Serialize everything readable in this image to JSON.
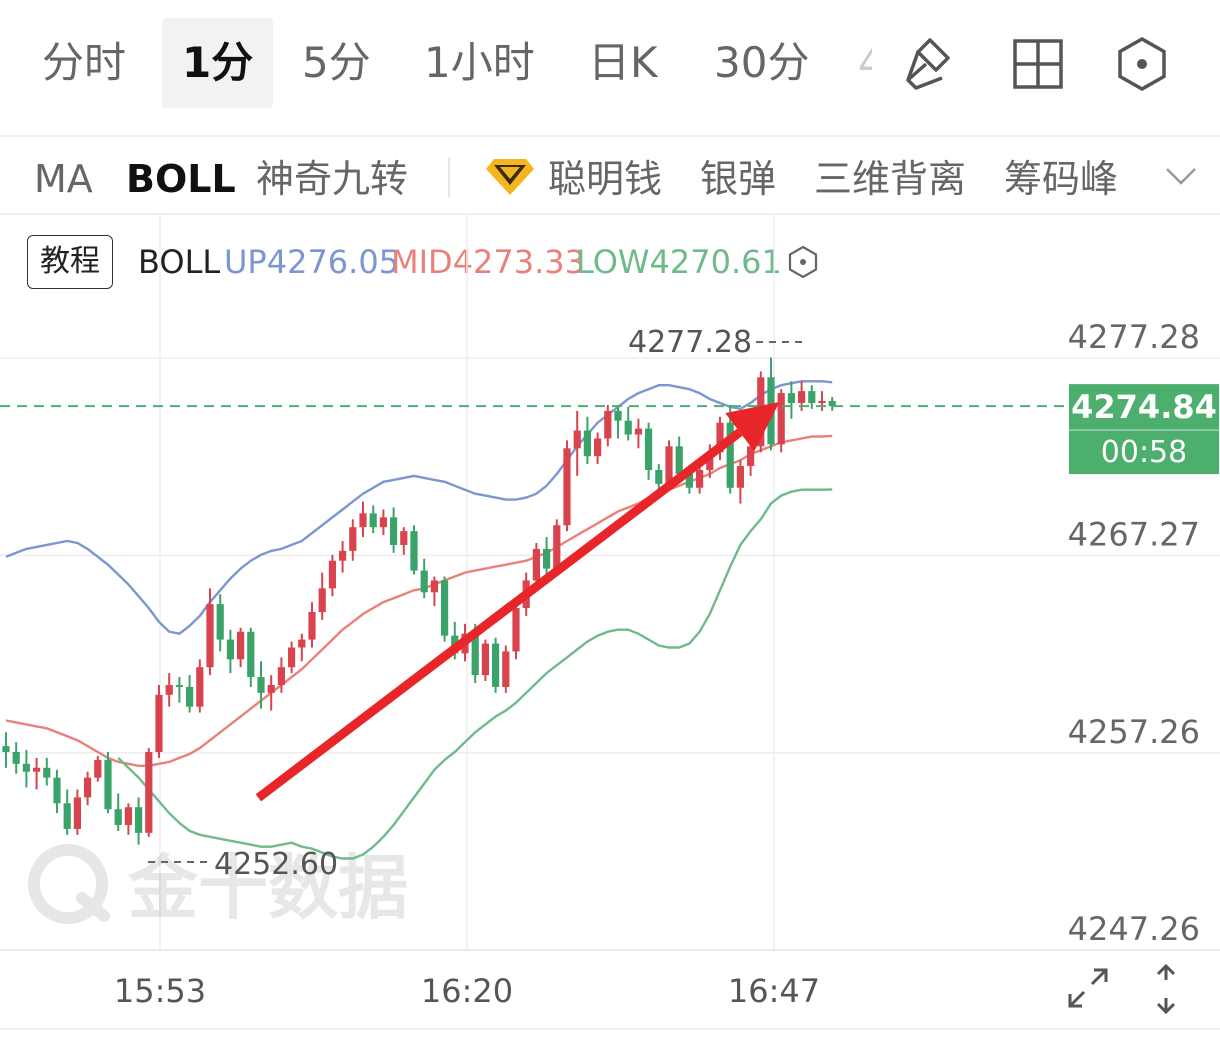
{
  "timeframe_tabs": [
    {
      "label": "分时",
      "active": false
    },
    {
      "label": "1分",
      "active": true
    },
    {
      "label": "5分",
      "active": false
    },
    {
      "label": "1小时",
      "active": false
    },
    {
      "label": "日K",
      "active": false
    },
    {
      "label": "30分",
      "active": false
    },
    {
      "label": "4",
      "active": false
    }
  ],
  "indicator_tabs": [
    {
      "label": "MA",
      "active": false
    },
    {
      "label": "BOLL",
      "active": true
    },
    {
      "label": "神奇九转",
      "active": false
    },
    {
      "label": "聪明钱",
      "active": false
    },
    {
      "label": "银弹",
      "active": false
    },
    {
      "label": "三维背离",
      "active": false
    },
    {
      "label": "筹码峰",
      "active": false
    }
  ],
  "legend": {
    "tutorial_label": "教程",
    "indicator_name": "BOLL",
    "up": "UP4276.05",
    "mid": "MID4273.33",
    "low": "LOW4270.61"
  },
  "colors": {
    "up_candle": "#d9434e",
    "down_candle": "#3aa36a",
    "boll_up": "#7b96d0",
    "boll_mid": "#e9807a",
    "boll_low": "#6fba8a",
    "current_price_bg": "#4caf6e",
    "arrow": "#e8262a",
    "active_tab_bg": "#f2f2f2"
  },
  "icons": [
    "draw-line-icon",
    "grid-layout-icon",
    "settings-hex-icon",
    "chevron-down-icon",
    "fullscreen-icon",
    "vertical-resize-icon"
  ],
  "chart_data": {
    "type": "candlestick",
    "interval": "1分",
    "y_axis_ticks": [
      "4277.28",
      "4267.27",
      "4257.26",
      "4247.26"
    ],
    "ylim": [
      4247.26,
      4277.28
    ],
    "x_axis_ticks": [
      "15:53",
      "16:20",
      "16:47"
    ],
    "current_price": "4274.84",
    "countdown": "00:58",
    "max_annotation": "4277.28",
    "min_annotation": "4252.60",
    "watermark": "金十数据",
    "annotation_arrow": {
      "direction": "up",
      "from": {
        "bar": 22,
        "price": 4256.5
      },
      "to": {
        "bar": 68,
        "price": 4274.9
      }
    },
    "candles": [
      [
        4257.6,
        4258.3,
        4256.5,
        4257.3
      ],
      [
        4257.3,
        4257.8,
        4256.2,
        4256.7
      ],
      [
        4256.7,
        4257.4,
        4255.5,
        4256.3
      ],
      [
        4256.3,
        4257.0,
        4255.4,
        4256.5
      ],
      [
        4256.5,
        4257.0,
        4255.6,
        4256.0
      ],
      [
        4256.0,
        4256.4,
        4254.2,
        4254.7
      ],
      [
        4254.7,
        4255.4,
        4253.1,
        4253.4
      ],
      [
        4253.4,
        4255.4,
        4253.1,
        4255.0
      ],
      [
        4255.0,
        4256.3,
        4254.6,
        4256.0
      ],
      [
        4256.0,
        4257.1,
        4255.8,
        4256.9
      ],
      [
        4256.9,
        4257.3,
        4254.2,
        4254.4
      ],
      [
        4254.4,
        4255.2,
        4253.3,
        4253.6
      ],
      [
        4253.6,
        4254.7,
        4253.1,
        4254.5
      ],
      [
        4254.5,
        4255.0,
        4252.6,
        4253.2
      ],
      [
        4253.2,
        4257.5,
        4253.0,
        4257.3
      ],
      [
        4257.3,
        4260.7,
        4257.0,
        4260.2
      ],
      [
        4260.2,
        4261.3,
        4259.6,
        4260.7
      ],
      [
        4260.7,
        4261.1,
        4259.8,
        4260.6
      ],
      [
        4260.6,
        4261.2,
        4259.3,
        4259.6
      ],
      [
        4259.6,
        4262.0,
        4259.3,
        4261.6
      ],
      [
        4261.6,
        4265.6,
        4261.2,
        4264.8
      ],
      [
        4264.8,
        4265.3,
        4262.4,
        4263.0
      ],
      [
        4263.0,
        4263.5,
        4261.3,
        4262.0
      ],
      [
        4262.0,
        4263.6,
        4261.6,
        4263.4
      ],
      [
        4263.4,
        4263.6,
        4260.6,
        4261.1
      ],
      [
        4261.1,
        4261.9,
        4259.5,
        4260.3
      ],
      [
        4260.3,
        4261.2,
        4259.4,
        4260.7
      ],
      [
        4260.7,
        4262.1,
        4260.3,
        4261.6
      ],
      [
        4261.6,
        4262.9,
        4261.3,
        4262.6
      ],
      [
        4262.6,
        4263.3,
        4261.9,
        4263.0
      ],
      [
        4263.0,
        4264.9,
        4262.6,
        4264.4
      ],
      [
        4264.4,
        4266.4,
        4264.0,
        4265.6
      ],
      [
        4265.6,
        4267.3,
        4265.2,
        4267.0
      ],
      [
        4267.0,
        4268.0,
        4266.4,
        4267.5
      ],
      [
        4267.5,
        4269.1,
        4267.0,
        4268.7
      ],
      [
        4268.7,
        4270.0,
        4268.2,
        4269.4
      ],
      [
        4269.4,
        4269.8,
        4268.4,
        4268.7
      ],
      [
        4268.7,
        4269.6,
        4268.3,
        4269.2
      ],
      [
        4269.2,
        4269.7,
        4267.4,
        4267.8
      ],
      [
        4267.8,
        4268.7,
        4267.3,
        4268.5
      ],
      [
        4268.5,
        4268.8,
        4266.3,
        4266.5
      ],
      [
        4266.5,
        4267.1,
        4265.1,
        4265.4
      ],
      [
        4265.4,
        4266.2,
        4264.7,
        4266.0
      ],
      [
        4266.0,
        4266.2,
        4262.9,
        4263.2
      ],
      [
        4263.2,
        4263.9,
        4262.0,
        4262.3
      ],
      [
        4262.3,
        4263.8,
        4261.9,
        4263.3
      ],
      [
        4263.3,
        4263.8,
        4260.8,
        4261.2
      ],
      [
        4261.2,
        4263.0,
        4260.9,
        4262.8
      ],
      [
        4262.8,
        4263.1,
        4260.3,
        4260.6
      ],
      [
        4260.6,
        4262.7,
        4260.3,
        4262.4
      ],
      [
        4262.4,
        4265.0,
        4262.0,
        4264.6
      ],
      [
        4264.6,
        4266.4,
        4264.2,
        4266.0
      ],
      [
        4266.0,
        4267.9,
        4265.6,
        4267.6
      ],
      [
        4267.6,
        4268.2,
        4266.3,
        4266.6
      ],
      [
        4266.6,
        4269.1,
        4266.3,
        4268.8
      ],
      [
        4268.8,
        4273.1,
        4268.5,
        4272.7
      ],
      [
        4272.7,
        4274.6,
        4271.3,
        4273.6
      ],
      [
        4273.6,
        4274.3,
        4271.9,
        4272.3
      ],
      [
        4272.3,
        4273.5,
        4271.9,
        4273.2
      ],
      [
        4273.2,
        4274.9,
        4272.8,
        4274.6
      ],
      [
        4274.6,
        4274.9,
        4273.2,
        4274.1
      ],
      [
        4274.1,
        4274.8,
        4273.1,
        4273.4
      ],
      [
        4273.4,
        4274.2,
        4272.7,
        4273.7
      ],
      [
        4273.7,
        4274.0,
        4271.1,
        4271.6
      ],
      [
        4271.6,
        4271.9,
        4270.5,
        4270.9
      ],
      [
        4270.9,
        4273.1,
        4270.6,
        4272.8
      ],
      [
        4272.8,
        4273.3,
        4271.1,
        4271.4
      ],
      [
        4271.4,
        4271.8,
        4270.4,
        4270.7
      ],
      [
        4270.7,
        4271.9,
        4270.4,
        4271.6
      ],
      [
        4271.6,
        4272.9,
        4271.2,
        4272.5
      ],
      [
        4272.5,
        4274.3,
        4272.1,
        4274.0
      ],
      [
        4274.0,
        4274.9,
        4270.4,
        4270.7
      ],
      [
        4270.7,
        4272.1,
        4269.9,
        4271.8
      ],
      [
        4271.8,
        4273.1,
        4271.3,
        4272.8
      ],
      [
        4272.8,
        4276.6,
        4272.5,
        4276.3
      ],
      [
        4276.3,
        4277.3,
        4272.6,
        4272.9
      ],
      [
        4272.9,
        4275.7,
        4272.5,
        4275.5
      ],
      [
        4275.5,
        4276.1,
        4274.2,
        4275.0
      ],
      [
        4275.0,
        4276.1,
        4274.6,
        4275.6
      ],
      [
        4275.6,
        4275.9,
        4274.7,
        4275.0
      ],
      [
        4275.0,
        4275.6,
        4274.6,
        4275.1
      ],
      [
        4275.1,
        4275.3,
        4274.6,
        4274.84
      ]
    ],
    "boll_up": [
      4267.2,
      4267.4,
      4267.6,
      4267.7,
      4267.8,
      4267.9,
      4268.0,
      4267.9,
      4267.6,
      4267.2,
      4266.8,
      4266.3,
      4265.8,
      4265.2,
      4264.6,
      4263.9,
      4263.4,
      4263.3,
      4263.7,
      4264.2,
      4264.9,
      4265.5,
      4266.1,
      4266.6,
      4267.0,
      4267.3,
      4267.5,
      4267.6,
      4267.8,
      4268.0,
      4268.4,
      4268.8,
      4269.2,
      4269.6,
      4270.0,
      4270.4,
      4270.7,
      4271.0,
      4271.1,
      4271.2,
      4271.3,
      4271.2,
      4271.1,
      4271.0,
      4270.8,
      4270.6,
      4270.4,
      4270.3,
      4270.2,
      4270.1,
      4270.1,
      4270.2,
      4270.4,
      4270.8,
      4271.4,
      4272.1,
      4272.8,
      4273.4,
      4274.0,
      4274.4,
      4274.8,
      4275.2,
      4275.5,
      4275.7,
      4275.9,
      4275.9,
      4275.8,
      4275.7,
      4275.5,
      4275.2,
      4275.0,
      4274.8,
      4274.7,
      4275.0,
      4275.4,
      4275.7,
      4275.9,
      4276.0,
      4276.1,
      4276.1,
      4276.1,
      4276.05
    ],
    "boll_mid": [
      4258.9,
      4258.8,
      4258.7,
      4258.6,
      4258.5,
      4258.3,
      4258.1,
      4257.9,
      4257.6,
      4257.3,
      4257.0,
      4256.8,
      4256.7,
      4256.6,
      4256.6,
      4256.7,
      4256.8,
      4257.0,
      4257.2,
      4257.5,
      4257.9,
      4258.3,
      4258.7,
      4259.1,
      4259.5,
      4259.9,
      4260.3,
      4260.7,
      4261.1,
      4261.5,
      4262.0,
      4262.5,
      4263.0,
      4263.5,
      4263.9,
      4264.3,
      4264.6,
      4264.9,
      4265.1,
      4265.3,
      4265.5,
      4265.6,
      4265.8,
      4266.0,
      4266.2,
      4266.4,
      4266.5,
      4266.6,
      4266.7,
      4266.8,
      4266.9,
      4267.0,
      4267.2,
      4267.4,
      4267.7,
      4268.0,
      4268.3,
      4268.6,
      4268.9,
      4269.2,
      4269.5,
      4269.7,
      4269.9,
      4270.2,
      4270.4,
      4270.6,
      4270.8,
      4271.0,
      4271.2,
      4271.4,
      4271.7,
      4271.9,
      4272.1,
      4272.4,
      4272.6,
      4272.8,
      4273.0,
      4273.1,
      4273.2,
      4273.3,
      4273.3,
      4273.33
    ],
    "boll_low": [
      4257.0,
      4256.5,
      4256.0,
      4255.4,
      4254.8,
      4254.2,
      4253.7,
      4253.3,
      4253.1,
      4253.0,
      4252.9,
      4252.8,
      4252.7,
      4252.6,
      4252.5,
      4252.5,
      4252.6,
      4252.7,
      4252.5,
      4252.4,
      4252.2,
      4252.0,
      4251.9,
      4251.9,
      4252.1,
      4252.5,
      4253.0,
      4253.6,
      4254.3,
      4255.0,
      4255.7,
      4256.4,
      4256.9,
      4257.3,
      4257.8,
      4258.3,
      4258.7,
      4259.1,
      4259.4,
      4259.8,
      4260.3,
      4260.8,
      4261.3,
      4261.7,
      4262.1,
      4262.5,
      4262.9,
      4263.2,
      4263.4,
      4263.5,
      4263.5,
      4263.3,
      4263.0,
      4262.7,
      4262.6,
      4262.6,
      4262.8,
      4263.4,
      4264.3,
      4265.5,
      4266.7,
      4267.8,
      4268.5,
      4269.1,
      4269.9,
      4270.3,
      4270.5,
      4270.6,
      4270.6,
      4270.6,
      4270.61
    ],
    "boll_low_start": 11
  }
}
